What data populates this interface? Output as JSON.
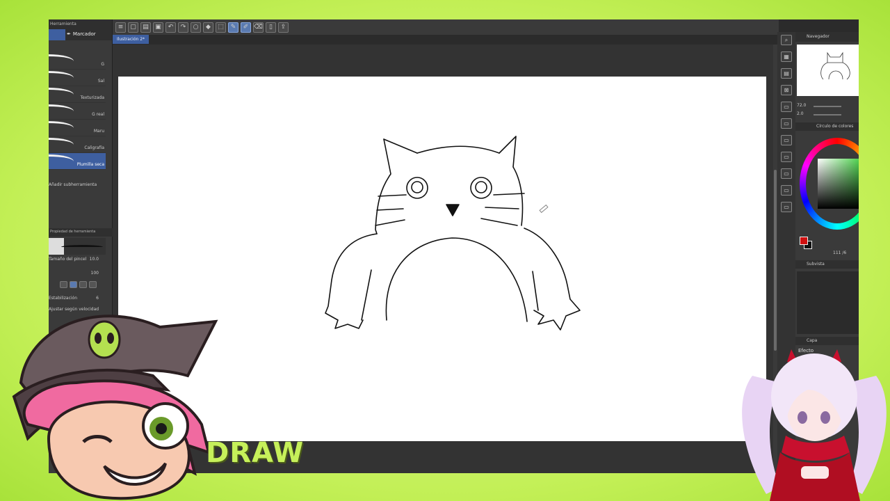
{
  "toolbar": {
    "icons": [
      "menu-icon",
      "new-icon",
      "open-icon",
      "save-icon",
      "undo-icon",
      "redo-icon",
      "circle-icon",
      "fill-icon",
      "transform-icon",
      "pen-icon",
      "pencil-icon",
      "eraser-icon",
      "device-icon",
      "export-icon"
    ],
    "active_index": 9
  },
  "document_tab": {
    "label": "Ilustración 2*"
  },
  "left_panel": {
    "header": "Herramienta",
    "subtool_group": "Marcador",
    "brushes": [
      {
        "label": "G"
      },
      {
        "label": "Sal"
      },
      {
        "label": "Texturizada"
      },
      {
        "label": "G real"
      },
      {
        "label": "Maru"
      },
      {
        "label": "Caligrafía"
      },
      {
        "label": "Plumilla seca"
      }
    ],
    "active_brush_index": 6,
    "add_subtool": "Añadir subherramienta",
    "properties_header": "Propiedad de herramienta",
    "brush_size_label": "Tamaño del pincel",
    "brush_size_value": "10.0",
    "opacity_value": "100",
    "stabilization_label": "Estabilización",
    "stabilization_value": "6",
    "speed_label": "Ajustar según velocidad"
  },
  "right_panel": {
    "navigator_tab": "Navegador",
    "zoom_value": "72.0",
    "rotation_value": "2.0",
    "color_circle_header": "Círculo de colores",
    "main_color": "#d01010",
    "sub_color": "#111111",
    "color_value": "111 /6",
    "sub_view_header": "Subvista",
    "layer_header": "Capa",
    "blend_mode": "Efecto"
  },
  "overlay": {
    "draw_text": "DRAW",
    "accent_color": "#c6f05a"
  }
}
